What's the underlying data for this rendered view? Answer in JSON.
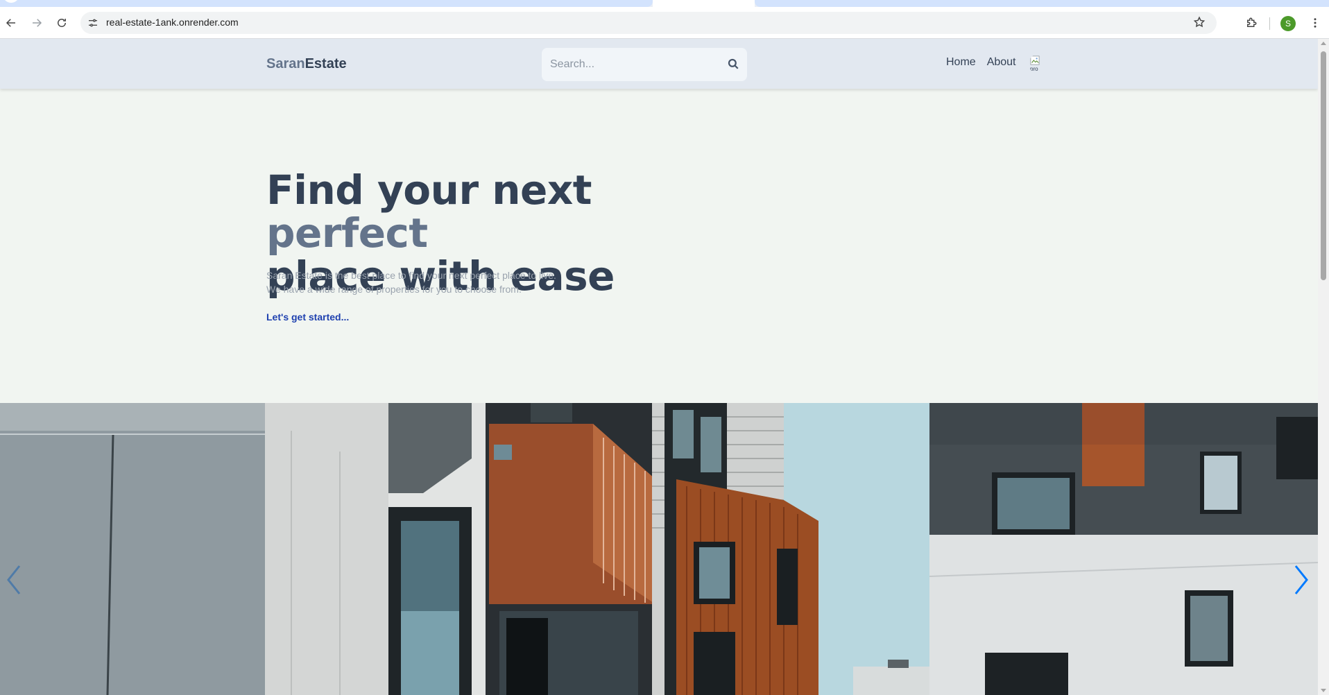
{
  "browser": {
    "url": "real-estate-1ank.onrender.com",
    "profile_initial": "S",
    "profile_color": "#4c9a2a",
    "icons": {
      "back": "arrow-left-icon",
      "forward": "arrow-right-icon",
      "reload": "reload-icon",
      "site_info": "tune-icon",
      "bookmark": "star-icon",
      "extensions": "puzzle-icon",
      "menu": "kebab-menu-icon"
    }
  },
  "header": {
    "brand_part1": "Saran",
    "brand_part2": "Estate",
    "search_placeholder": "Search...",
    "search_icon": "search-icon",
    "nav": {
      "home": "Home",
      "about": "About"
    },
    "avatar_alt": "pro"
  },
  "hero": {
    "title_part1": "Find your next ",
    "title_accent": "perfect",
    "title_part2": "place with ease",
    "line1": "Saran Estate is the best place to find your next perfect place to live.",
    "line2": "We have a wide range of properties for you to choose from.",
    "cta": "Let's get started..."
  },
  "slider": {
    "prev_icon": "chevron-left-icon",
    "next_icon": "chevron-right-icon",
    "image": "apartment-buildings-photo",
    "arrow_color": "#007aff"
  },
  "colors": {
    "header_bg": "#e2e8f0",
    "page_bg": "#f1f5f1",
    "title": "#334155",
    "accent": "#64748b",
    "cta": "#1e40af"
  }
}
